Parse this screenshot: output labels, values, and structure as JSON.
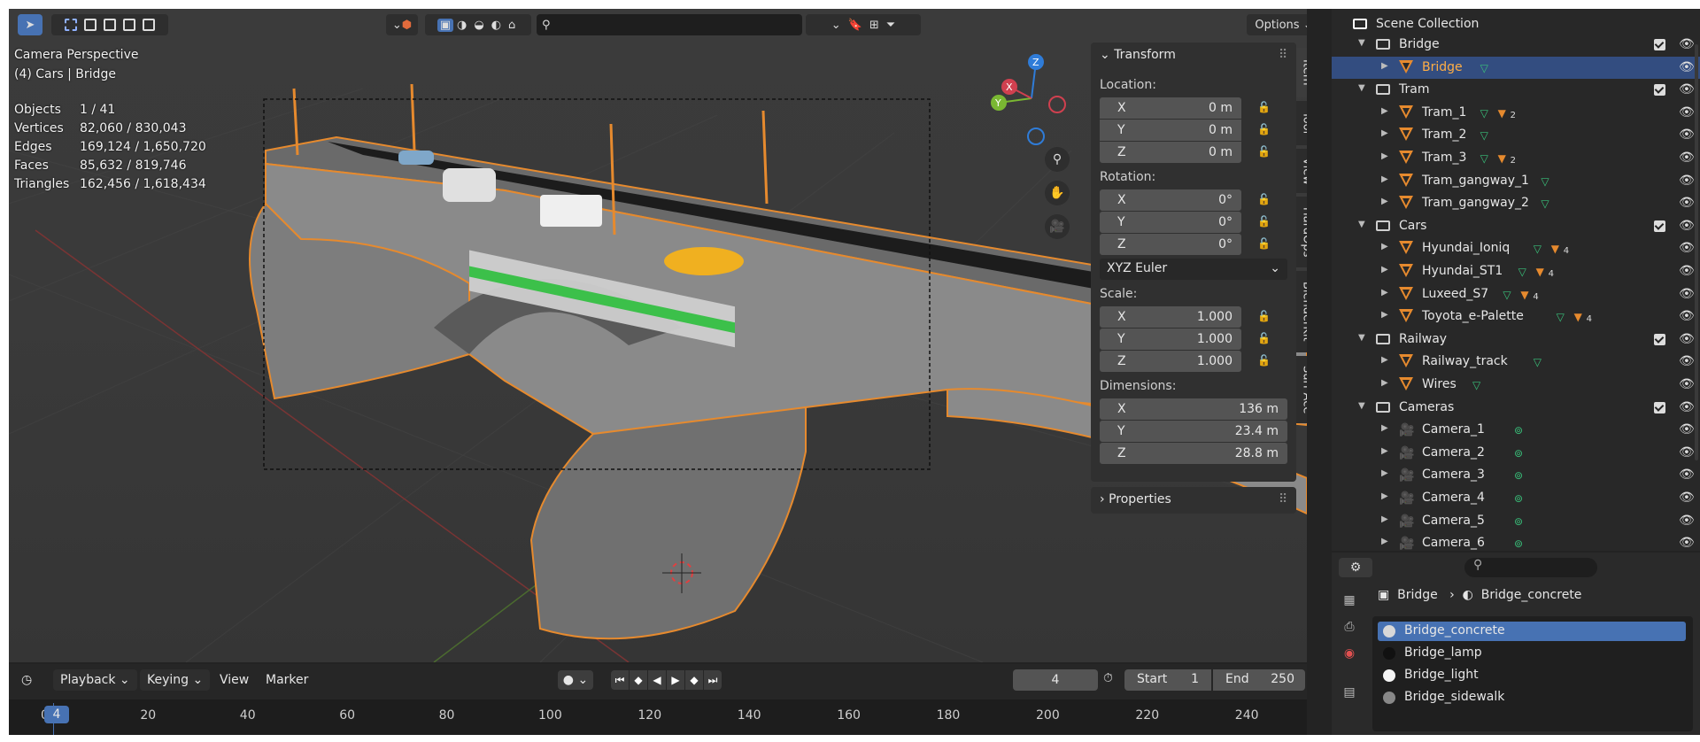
{
  "viewport": {
    "overlay_title": "Camera Perspective",
    "overlay_subtitle": "(4) Cars | Bridge",
    "stats": [
      {
        "label": "Objects",
        "value": "1 / 41"
      },
      {
        "label": "Vertices",
        "value": "82,060 / 830,043"
      },
      {
        "label": "Edges",
        "value": "169,124 / 1,650,720"
      },
      {
        "label": "Faces",
        "value": "85,632 / 819,746"
      },
      {
        "label": "Triangles",
        "value": "162,456 / 1,618,434"
      }
    ],
    "options_label": "Options",
    "gizmo": {
      "z": "Z",
      "y": "Y",
      "x": "X"
    }
  },
  "npanel": {
    "transform_title": "Transform",
    "location_label": "Location:",
    "location": [
      {
        "axis": "X",
        "value": "0 m"
      },
      {
        "axis": "Y",
        "value": "0 m"
      },
      {
        "axis": "Z",
        "value": "0 m"
      }
    ],
    "rotation_label": "Rotation:",
    "rotation": [
      {
        "axis": "X",
        "value": "0°"
      },
      {
        "axis": "Y",
        "value": "0°"
      },
      {
        "axis": "Z",
        "value": "0°"
      }
    ],
    "rotation_mode": "XYZ Euler",
    "scale_label": "Scale:",
    "scale": [
      {
        "axis": "X",
        "value": "1.000"
      },
      {
        "axis": "Y",
        "value": "1.000"
      },
      {
        "axis": "Z",
        "value": "1.000"
      }
    ],
    "dimensions_label": "Dimensions:",
    "dimensions": [
      {
        "axis": "X",
        "value": "136 m"
      },
      {
        "axis": "Y",
        "value": "23.4 m"
      },
      {
        "axis": "Z",
        "value": "28.8 m"
      }
    ],
    "properties_title": "Properties",
    "tabs": [
      "Item",
      "Tool",
      "View",
      "HardOps",
      "BlenderKit",
      "Surf Ace"
    ]
  },
  "outliner": {
    "root": "Scene Collection",
    "rows": [
      {
        "label": "Bridge",
        "type": "collection",
        "indent": 1
      },
      {
        "label": "Bridge",
        "type": "object",
        "indent": 2,
        "selected": true
      },
      {
        "label": "Tram",
        "type": "collection",
        "indent": 1
      },
      {
        "label": "Tram_1",
        "type": "object",
        "indent": 2,
        "badge": "2"
      },
      {
        "label": "Tram_2",
        "type": "object",
        "indent": 2
      },
      {
        "label": "Tram_3",
        "type": "object",
        "indent": 2,
        "badge": "2"
      },
      {
        "label": "Tram_gangway_1",
        "type": "object",
        "indent": 2
      },
      {
        "label": "Tram_gangway_2",
        "type": "object",
        "indent": 2
      },
      {
        "label": "Cars",
        "type": "collection",
        "indent": 1
      },
      {
        "label": "Hyundai_Ioniq",
        "type": "object",
        "indent": 2,
        "badge": "4"
      },
      {
        "label": "Hyundai_ST1",
        "type": "object",
        "indent": 2,
        "badge": "4"
      },
      {
        "label": "Luxeed_S7",
        "type": "object",
        "indent": 2,
        "badge": "4"
      },
      {
        "label": "Toyota_e-Palette",
        "type": "object",
        "indent": 2,
        "badge": "4"
      },
      {
        "label": "Railway",
        "type": "collection",
        "indent": 1
      },
      {
        "label": "Railway_track",
        "type": "object",
        "indent": 2
      },
      {
        "label": "Wires",
        "type": "object",
        "indent": 2
      },
      {
        "label": "Cameras",
        "type": "collection",
        "indent": 1
      },
      {
        "label": "Camera_1",
        "type": "camera",
        "indent": 2
      },
      {
        "label": "Camera_2",
        "type": "camera",
        "indent": 2
      },
      {
        "label": "Camera_3",
        "type": "camera",
        "indent": 2
      },
      {
        "label": "Camera_4",
        "type": "camera",
        "indent": 2
      },
      {
        "label": "Camera_5",
        "type": "camera",
        "indent": 2
      },
      {
        "label": "Camera_6",
        "type": "camera",
        "indent": 2
      }
    ]
  },
  "properties": {
    "breadcrumb_object": "Bridge",
    "breadcrumb_material": "Bridge_concrete",
    "materials": [
      {
        "name": "Bridge_concrete",
        "color": "#d8d8d8",
        "selected": true
      },
      {
        "name": "Bridge_lamp",
        "color": "#111111"
      },
      {
        "name": "Bridge_light",
        "color": "#f5f5f5"
      },
      {
        "name": "Bridge_sidewalk",
        "color": "#888888"
      }
    ]
  },
  "timeline": {
    "menu": [
      "Playback",
      "Keying",
      "View",
      "Marker"
    ],
    "current_frame": "4",
    "start_label": "Start",
    "start": "1",
    "end_label": "End",
    "end": "250",
    "ticks": [
      "0",
      "20",
      "40",
      "60",
      "80",
      "100",
      "120",
      "140",
      "160",
      "180",
      "200",
      "220",
      "240"
    ],
    "playhead": "4"
  },
  "colors": {
    "accent": "#4772b3",
    "selection_outline": "#e68a2e",
    "green": "#39c07a"
  }
}
